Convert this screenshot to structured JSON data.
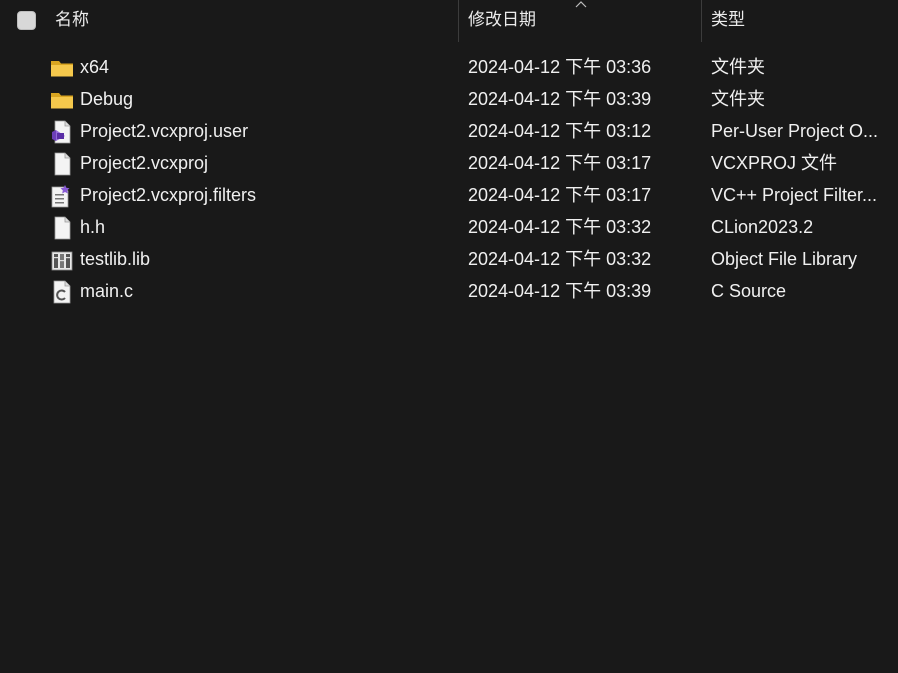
{
  "header": {
    "name_label": "名称",
    "date_label": "修改日期",
    "type_label": "类型",
    "sorted_column": "date",
    "sort_direction": "ascending"
  },
  "files": [
    {
      "name": "x64",
      "modified": "2024-04-12 下午 03:36",
      "type": "文件夹",
      "icon": "folder-icon"
    },
    {
      "name": "Debug",
      "modified": "2024-04-12 下午 03:39",
      "type": "文件夹",
      "icon": "folder-icon"
    },
    {
      "name": "Project2.vcxproj.user",
      "modified": "2024-04-12 下午 03:12",
      "type": "Per-User Project O...",
      "icon": "visual-studio-file-icon"
    },
    {
      "name": "Project2.vcxproj",
      "modified": "2024-04-12 下午 03:17",
      "type": "VCXPROJ 文件",
      "icon": "blank-file-icon"
    },
    {
      "name": "Project2.vcxproj.filters",
      "modified": "2024-04-12 下午 03:17",
      "type": "VC++ Project Filter...",
      "icon": "filters-file-icon"
    },
    {
      "name": "h.h",
      "modified": "2024-04-12 下午 03:32",
      "type": "CLion2023.2",
      "icon": "blank-file-icon"
    },
    {
      "name": "testlib.lib",
      "modified": "2024-04-12 下午 03:32",
      "type": "Object File Library",
      "icon": "library-file-icon"
    },
    {
      "name": "main.c",
      "modified": "2024-04-12 下午 03:39",
      "type": "C Source",
      "icon": "c-source-file-icon"
    }
  ],
  "colors": {
    "background": "#191919",
    "text": "#f0f0f0",
    "folder": "#f5c84c",
    "accent_purple": "#8a5bd6"
  }
}
